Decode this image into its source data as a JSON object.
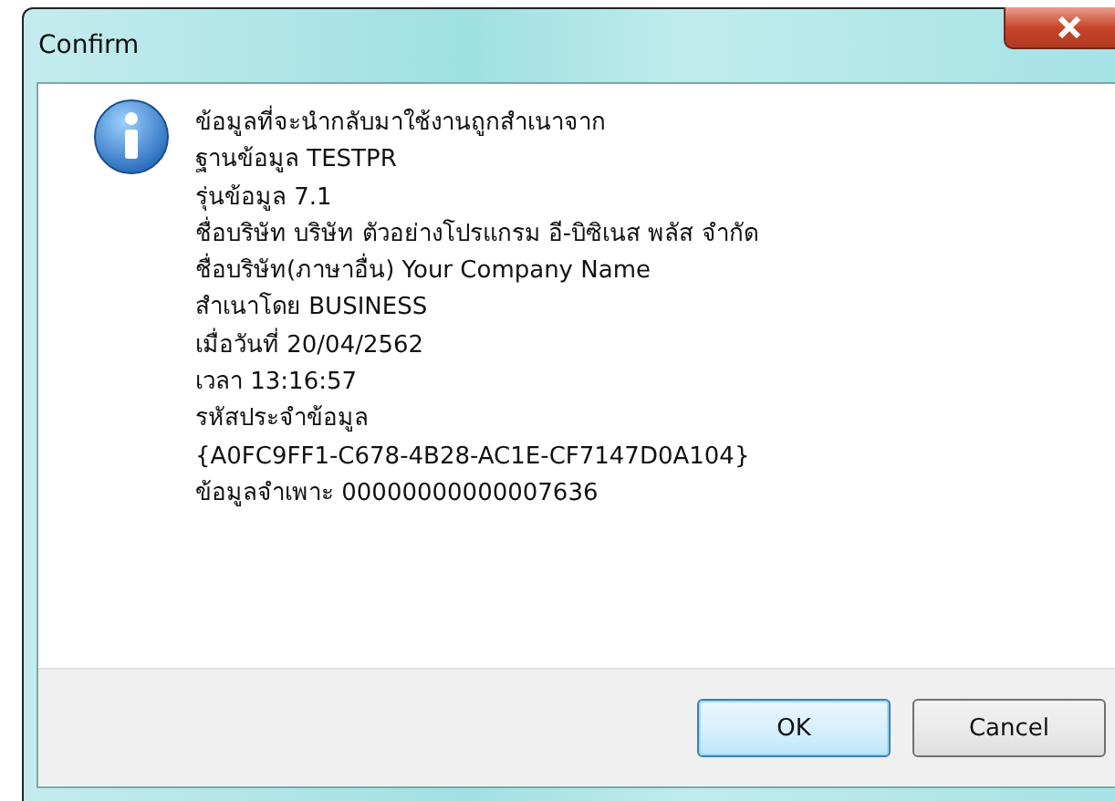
{
  "window": {
    "title": "Confirm"
  },
  "message_lines": [
    "ข้อมูลที่จะนำกลับมาใช้งานถูกสำเนาจาก",
    "ฐานข้อมูล TESTPR",
    "รุ่นข้อมูล 7.1",
    "ชื่อบริษัท บริษัท ตัวอย่างโปรแกรม อี-บิซิเนส พลัส  จำกัด",
    "ชื่อบริษัท(ภาษาอื่น) Your Company Name",
    "สำเนาโดย BUSINESS",
    "เมื่อวันที่ 20/04/2562",
    "เวลา 13:16:57",
    "รหัสประจำข้อมูล",
    "{A0FC9FF1-C678-4B28-AC1E-CF7147D0A104}",
    "ข้อมูลจำเพาะ 00000000000007636"
  ],
  "buttons": [
    {
      "label": "OK",
      "default": true
    },
    {
      "label": "Cancel",
      "default": false
    }
  ]
}
